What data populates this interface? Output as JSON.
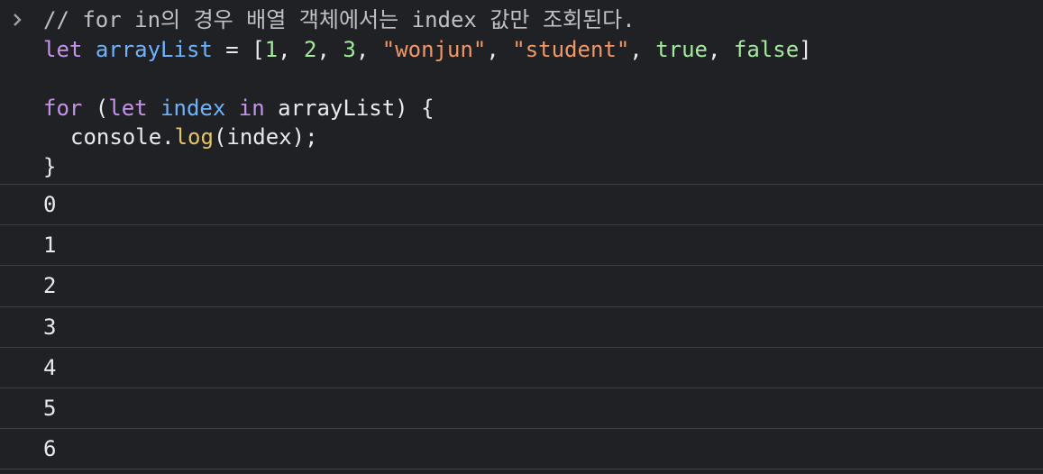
{
  "colors": {
    "background": "#202124",
    "divider": "#3c4043",
    "comment": "#bdc1c6",
    "keyword": "#c792ea",
    "variable": "#6fb3ff",
    "number": "#a5e8a0",
    "string": "#f29766",
    "function": "#e0c46c",
    "text": "#e8eaed"
  },
  "prompt_icon": "chevron-right-icon",
  "input": {
    "comment": "// for in의 경우 배열 객체에서는 index 값만 조회된다.",
    "line2": {
      "kw_let": "let",
      "var_name": "arrayList",
      "eq": " = ",
      "open": "[",
      "n1": "1",
      "n2": "2",
      "n3": "3",
      "s1": "\"wonjun\"",
      "s2": "\"student\"",
      "b1": "true",
      "b2": "false",
      "close": "]",
      "sep": ", "
    },
    "line4": {
      "kw_for": "for",
      "open": " (",
      "kw_let": "let",
      "var_index": "index",
      "kw_in": "in",
      "rest": " arrayList) {"
    },
    "line5": {
      "obj": "console.",
      "fn": "log",
      "args": "(index);"
    },
    "line6": "}"
  },
  "outputs": [
    "0",
    "1",
    "2",
    "3",
    "4",
    "5",
    "6"
  ]
}
